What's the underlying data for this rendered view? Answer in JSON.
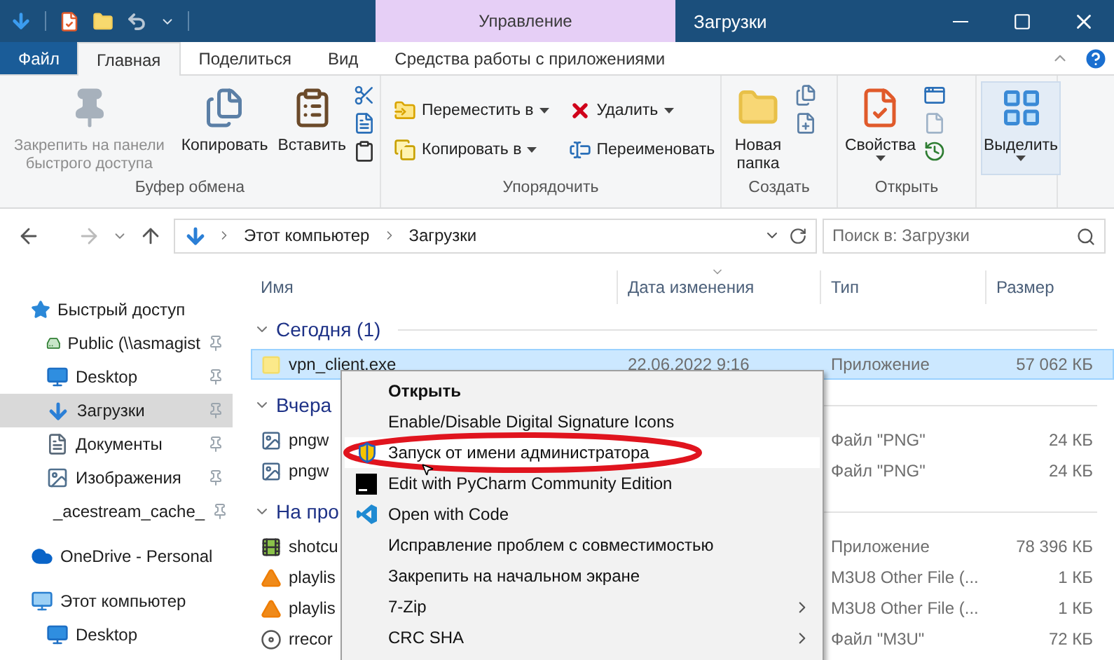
{
  "window": {
    "title": "Загрузки",
    "context_tab": "Управление"
  },
  "ribbon_tabs": [
    {
      "label": "Файл",
      "kind": "file",
      "selected": false
    },
    {
      "label": "Главная",
      "kind": "tab",
      "selected": true
    },
    {
      "label": "Поделиться",
      "kind": "tab",
      "selected": false
    },
    {
      "label": "Вид",
      "kind": "tab",
      "selected": false
    },
    {
      "label": "Средства работы с приложениями",
      "kind": "tab",
      "selected": false
    }
  ],
  "ribbon": {
    "clipboard": {
      "label": "Буфер обмена",
      "buttons": [
        {
          "label": "Закрепить на панели быстрого доступа",
          "disabled": true
        },
        {
          "label": "Копировать",
          "disabled": false
        },
        {
          "label": "Вставить",
          "disabled": false
        }
      ]
    },
    "organize": {
      "label": "Упорядочить",
      "buttons": [
        {
          "label": "Переместить в",
          "dropdown": true
        },
        {
          "label": "Копировать в",
          "dropdown": true
        },
        {
          "label": "Удалить",
          "dropdown": true
        },
        {
          "label": "Переименовать",
          "dropdown": false
        }
      ]
    },
    "new": {
      "label": "Создать",
      "button": "Новая папка"
    },
    "open": {
      "label": "Открыть",
      "button": "Свойства"
    },
    "select": {
      "button": "Выделить"
    }
  },
  "address_bar": {
    "path": [
      "Этот компьютер",
      "Загрузки"
    ]
  },
  "search": {
    "placeholder": "Поиск в: Загрузки"
  },
  "nav_pane": [
    {
      "label": "Быстрый доступ",
      "children": [
        {
          "label": "Public (\\\\asmagist",
          "pinned": true,
          "selected": false
        },
        {
          "label": "Desktop",
          "pinned": true,
          "selected": false
        },
        {
          "label": "Загрузки",
          "pinned": true,
          "selected": true
        },
        {
          "label": "Документы",
          "pinned": true,
          "selected": false
        },
        {
          "label": "Изображения",
          "pinned": true,
          "selected": false
        },
        {
          "label": "_acestream_cache_",
          "pinned": true,
          "selected": false
        }
      ]
    },
    {
      "label": "OneDrive - Personal"
    },
    {
      "label": "Этот компьютер",
      "children": [
        {
          "label": "Desktop",
          "pinned": false,
          "selected": false
        }
      ]
    }
  ],
  "columns": [
    "Имя",
    "Дата изменения",
    "Тип",
    "Размер"
  ],
  "file_groups": [
    {
      "label": "Сегодня (1)",
      "rows": [
        {
          "name": "vpn_client.exe",
          "date": "22.06.2022 9:16",
          "type": "Приложение",
          "size": "57 062 КБ",
          "selected": true
        }
      ]
    },
    {
      "label": "Вчера",
      "rows": [
        {
          "name": "pngw",
          "type": "Файл \"PNG\"",
          "size": "24 КБ",
          "selected": false
        },
        {
          "name": "pngw",
          "type": "Файл \"PNG\"",
          "size": "24 КБ",
          "selected": false
        }
      ]
    },
    {
      "label": "На про",
      "rows": [
        {
          "name": "shotcu",
          "type": "Приложение",
          "size": "78 396 КБ",
          "selected": false
        },
        {
          "name": "playlis",
          "type": "M3U8 Other File (...",
          "size": "1 КБ",
          "selected": false
        },
        {
          "name": "playlis",
          "type": "M3U8 Other File (...",
          "size": "1 КБ",
          "selected": false
        },
        {
          "name": "rrecor",
          "type": "Файл \"M3U\"",
          "size": "72 КБ",
          "selected": false
        }
      ]
    }
  ],
  "context_menu": [
    {
      "label": "Открыть",
      "default": true,
      "submenu": false,
      "selected": false
    },
    {
      "label": "Enable/Disable Digital Signature Icons",
      "default": false,
      "submenu": false,
      "selected": false
    },
    {
      "label": "Запуск от имени администратора",
      "default": false,
      "submenu": false,
      "selected": true
    },
    {
      "label": "Edit with PyCharm Community Edition",
      "default": false,
      "submenu": false,
      "selected": false
    },
    {
      "label": "Open with Code",
      "default": false,
      "submenu": false,
      "selected": false
    },
    {
      "label": "Исправление проблем с совместимостью",
      "default": false,
      "submenu": false,
      "selected": false
    },
    {
      "label": "Закрепить на начальном экране",
      "default": false,
      "submenu": false,
      "selected": false
    },
    {
      "label": "7-Zip",
      "default": false,
      "submenu": true,
      "selected": false
    },
    {
      "label": "CRC SHA",
      "default": false,
      "submenu": true,
      "selected": false
    }
  ]
}
